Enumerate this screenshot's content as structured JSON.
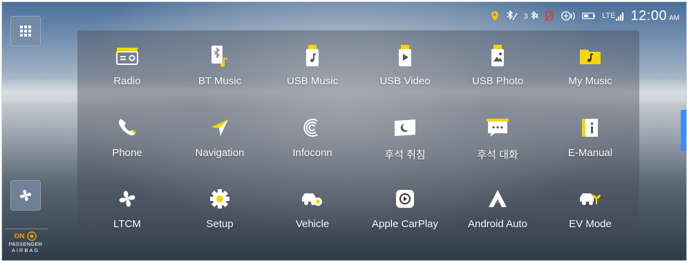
{
  "status": {
    "time": "12:00",
    "ampm": "AM",
    "network": "LTE",
    "bluetooth_count": "3"
  },
  "airbag": {
    "state": "ON",
    "line1": "PASSENGER",
    "line2": "AIRBAG"
  },
  "apps": [
    {
      "label": "Radio",
      "icon": "radio-icon"
    },
    {
      "label": "BT Music",
      "icon": "bt-music-icon"
    },
    {
      "label": "USB Music",
      "icon": "usb-music-icon"
    },
    {
      "label": "USB Video",
      "icon": "usb-video-icon"
    },
    {
      "label": "USB Photo",
      "icon": "usb-photo-icon"
    },
    {
      "label": "My Music",
      "icon": "my-music-icon"
    },
    {
      "label": "Phone",
      "icon": "phone-icon"
    },
    {
      "label": "Navigation",
      "icon": "navigation-icon"
    },
    {
      "label": "Infoconn",
      "icon": "infoconn-icon"
    },
    {
      "label": "후석 취침",
      "icon": "rear-sleep-icon"
    },
    {
      "label": "후석 대화",
      "icon": "rear-talk-icon"
    },
    {
      "label": "E-Manual",
      "icon": "e-manual-icon"
    },
    {
      "label": "LTCM",
      "icon": "ltcm-icon"
    },
    {
      "label": "Setup",
      "icon": "setup-icon"
    },
    {
      "label": "Vehicle",
      "icon": "vehicle-icon"
    },
    {
      "label": "Apple CarPlay",
      "icon": "apple-carplay-icon"
    },
    {
      "label": "Android Auto",
      "icon": "android-auto-icon"
    },
    {
      "label": "EV Mode",
      "icon": "ev-mode-icon"
    }
  ],
  "colors": {
    "accent": "#f5d800",
    "icon": "#ffffff"
  }
}
